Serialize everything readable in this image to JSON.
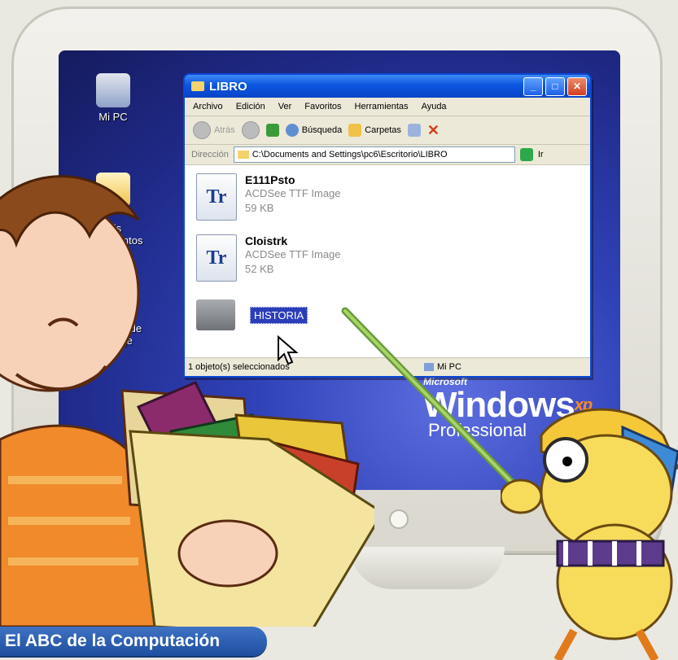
{
  "desktop_icons": [
    {
      "name": "mi-pc",
      "label": "Mi PC"
    },
    {
      "name": "mis-documentos",
      "label": "Mis\nDocumentos"
    },
    {
      "name": "papelera",
      "label": "Papelera de\nreciclaje"
    }
  ],
  "window": {
    "title": "LIBRO",
    "menu": [
      "Archivo",
      "Edición",
      "Ver",
      "Favoritos",
      "Herramientas",
      "Ayuda"
    ],
    "toolbar": {
      "back": "Atrás",
      "search": "Búsqueda",
      "folders": "Carpetas"
    },
    "address": {
      "label": "Dirección",
      "value": "C:\\Documents and Settings\\pc6\\Escritorio\\LIBRO",
      "go": "Ir"
    },
    "files": [
      {
        "name": "E111Psto",
        "type": "ACDSee TTF Image",
        "size": "59 KB",
        "icon_text": "Tr"
      },
      {
        "name": "Cloistrk",
        "type": "ACDSee TTF Image",
        "size": "52 KB",
        "icon_text": "Tr"
      }
    ],
    "folder": {
      "name": "HISTORIA"
    },
    "status": {
      "left": "1 objeto(s) seleccionados",
      "right": "Mi PC"
    }
  },
  "xp_logo": {
    "brand": "Microsoft",
    "product": "Windows",
    "sup": "xp",
    "edition": "Professional"
  },
  "caption": "El ABC de la Computación",
  "colors": {
    "title_blue": "#0b55e0",
    "desktop_blue": "#3042b8",
    "caption_blue": "#2a5fb4"
  }
}
